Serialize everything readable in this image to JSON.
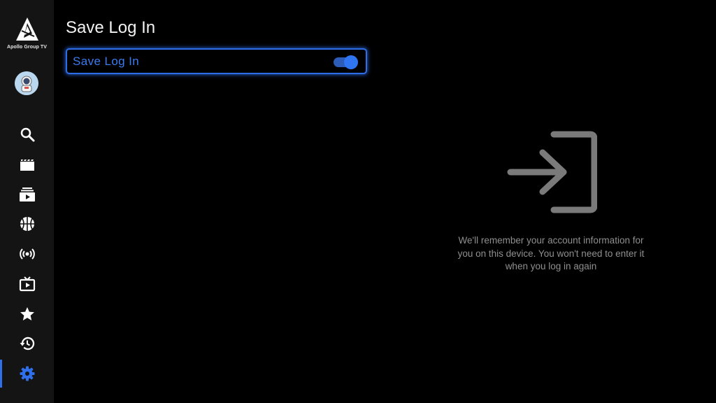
{
  "app": {
    "name": "Apollo Group TV",
    "accent_color": "#2f6fe8"
  },
  "sidebar": {
    "items": [
      {
        "id": "search",
        "icon": "search-icon",
        "active": false
      },
      {
        "id": "movies",
        "icon": "clapperboard-icon",
        "active": false
      },
      {
        "id": "series",
        "icon": "play-stack-icon",
        "active": false
      },
      {
        "id": "sports",
        "icon": "basketball-icon",
        "active": false
      },
      {
        "id": "live",
        "icon": "broadcast-icon",
        "active": false
      },
      {
        "id": "tv",
        "icon": "tv-play-icon",
        "active": false
      },
      {
        "id": "favorites",
        "icon": "star-icon",
        "active": false
      },
      {
        "id": "history",
        "icon": "history-icon",
        "active": false
      },
      {
        "id": "settings",
        "icon": "gear-icon",
        "active": true
      }
    ]
  },
  "page": {
    "title": "Save Log In"
  },
  "setting": {
    "label": "Save Log In",
    "enabled": true
  },
  "info": {
    "icon": "login-icon",
    "text": "We'll remember your account information for you on this device. You won't need to enter it when you log in again"
  }
}
